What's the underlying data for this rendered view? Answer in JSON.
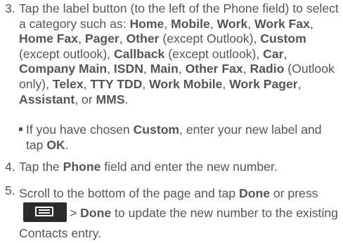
{
  "step3": {
    "num": "3.",
    "t1": "Tap the label button (to the left of the Phone field) to select a category such as: ",
    "home": "Home",
    "c1": ", ",
    "mobile": "Mobile",
    "c2": ", ",
    "work": "Work",
    "c3": ", ",
    "work_fax": "Work Fax",
    "c4": ", ",
    "home_fax": "Home Fax",
    "c5": ", ",
    "pager": "Pager",
    "c6": ", ",
    "other": "Other",
    "n1": " (except Outlook), ",
    "custom": "Custom",
    "n2": " (except outlook), ",
    "callback": "Callback",
    "n3": " (except outlook), ",
    "car": "Car",
    "c7": ", ",
    "company_main": "Company Main",
    "c8": ", ",
    "isdn": "ISDN",
    "c9": ", ",
    "main": "Main",
    "c10": ", ",
    "other_fax": "Other Fax",
    "c11": ", ",
    "radio": "Radio",
    "n4": " (Outlook only), ",
    "telex": "Telex",
    "c12": ", ",
    "tty_tdd": "TTY TDD",
    "c13": ", ",
    "work_mobile": "Work Mobile",
    "c14": ", ",
    "work_pager": "Work Pager",
    "c15": ", ",
    "assistant": "Assistant",
    "n5": ", or ",
    "mms": "MMS",
    "end": "."
  },
  "sub": {
    "t1": "If you have chosen ",
    "custom": "Custom",
    "t2": ", enter your new label and tap ",
    "ok": "OK",
    "end": "."
  },
  "step4": {
    "num": "4.",
    "t1": "Tap the ",
    "phone": "Phone",
    "t2": " field and enter the new number."
  },
  "step5": {
    "num": "5.",
    "t1": "Scroll to the bottom of the page and tap ",
    "done1": "Done",
    "t2": " or press ",
    "sep": "> ",
    "done2": "Done",
    "t3": " to update the new number to the existing Contacts entry."
  },
  "icons": {
    "menu_key": "menu-key-icon"
  },
  "colors": {
    "text": "#555555",
    "key_bg": "#2b2b2b"
  }
}
